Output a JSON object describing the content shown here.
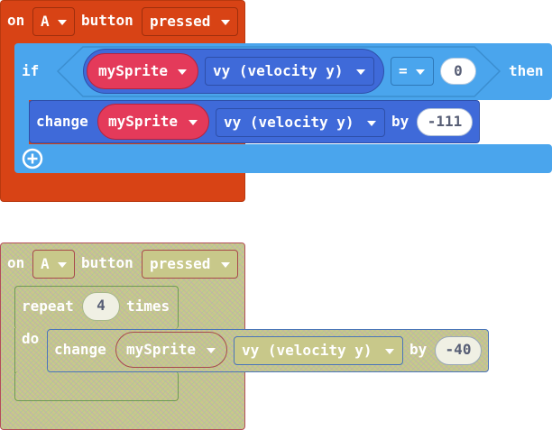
{
  "colors": {
    "event_block": "#d84315",
    "logic_block": "#4aa5ed",
    "sprite_variable": "#e43a5a",
    "sprite_property": "#3f6ad9",
    "disabled_block": "#c8c88a"
  },
  "block1": {
    "event": {
      "on": "on",
      "button": "A",
      "button_word": "button",
      "action": "pressed"
    },
    "if_label": "if",
    "condition": {
      "sprite": "mySprite",
      "property": "vy (velocity y)",
      "operator": "=",
      "value": "0"
    },
    "then_label": "then",
    "change": {
      "label": "change",
      "sprite": "mySprite",
      "property": "vy (velocity y)",
      "by_label": "by",
      "value": "-111"
    },
    "add_icon": "plus-circle-icon"
  },
  "block2": {
    "event": {
      "on": "on",
      "button": "A",
      "button_word": "button",
      "action": "pressed"
    },
    "repeat": {
      "label": "repeat",
      "count": "4",
      "times_label": "times",
      "do_label": "do"
    },
    "change": {
      "label": "change",
      "sprite": "mySprite",
      "property": "vy (velocity y)",
      "by_label": "by",
      "value": "-40"
    }
  }
}
